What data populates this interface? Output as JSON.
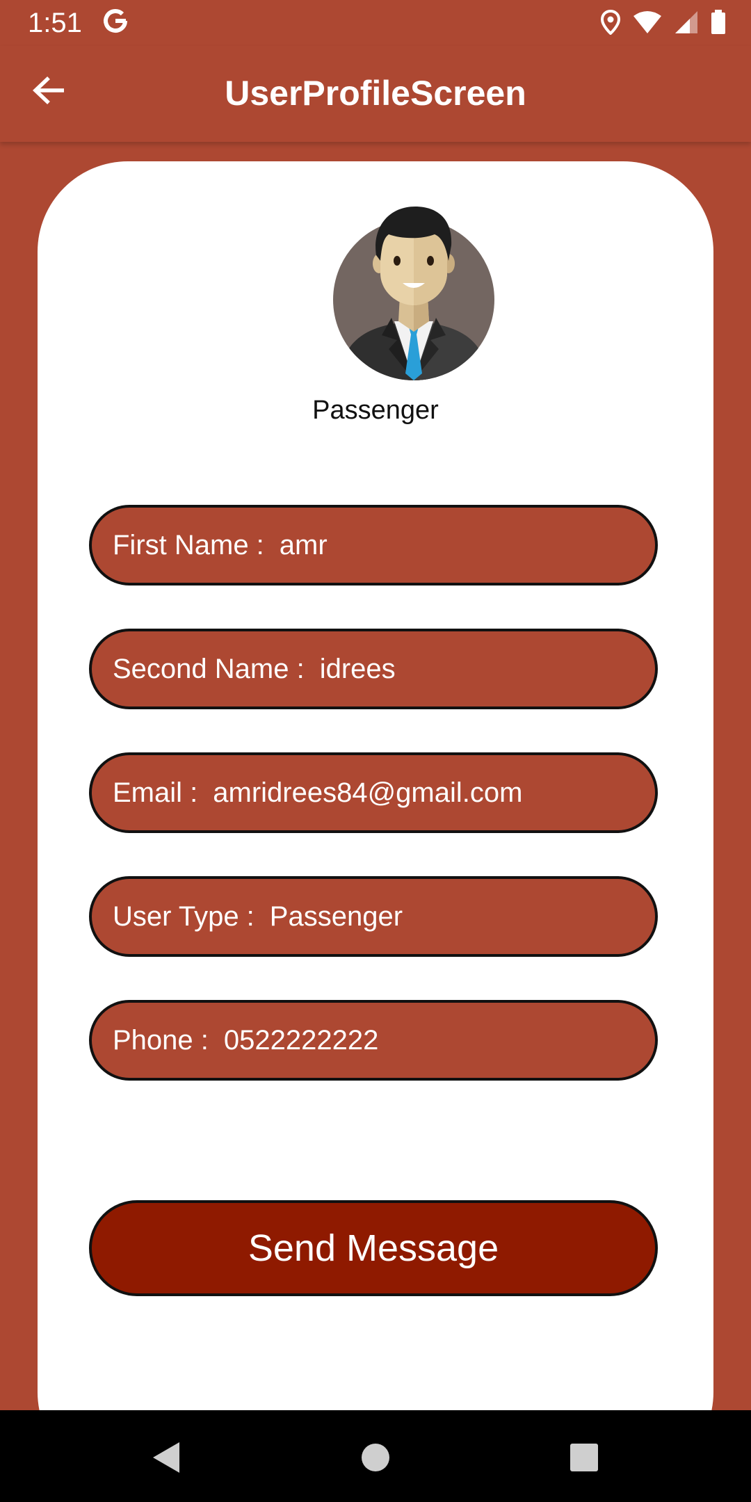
{
  "status_bar": {
    "time": "1:51",
    "icons": [
      "google-icon",
      "location-icon",
      "wifi-icon",
      "signal-icon",
      "battery-icon"
    ]
  },
  "app_bar": {
    "title": "UserProfileScreen",
    "back_icon": "arrow-back-icon"
  },
  "profile": {
    "avatar_icon": "businessman-avatar-icon",
    "role": "Passenger"
  },
  "fields": [
    {
      "label": "First Name :",
      "value": "amr"
    },
    {
      "label": "Second Name :",
      "value": "idrees"
    },
    {
      "label": "Email :",
      "value": "amridrees84@gmail.com"
    },
    {
      "label": "User Type :",
      "value": "Passenger"
    },
    {
      "label": "Phone :",
      "value": "0522222222"
    }
  ],
  "actions": {
    "send_message_label": "Send Message"
  },
  "nav_bar": {
    "icons": [
      "nav-back-icon",
      "nav-home-icon",
      "nav-recents-icon"
    ]
  },
  "colors": {
    "primary": "#ad4832",
    "button": "#8f1a00",
    "card": "#ffffff",
    "nav": "#000000"
  }
}
